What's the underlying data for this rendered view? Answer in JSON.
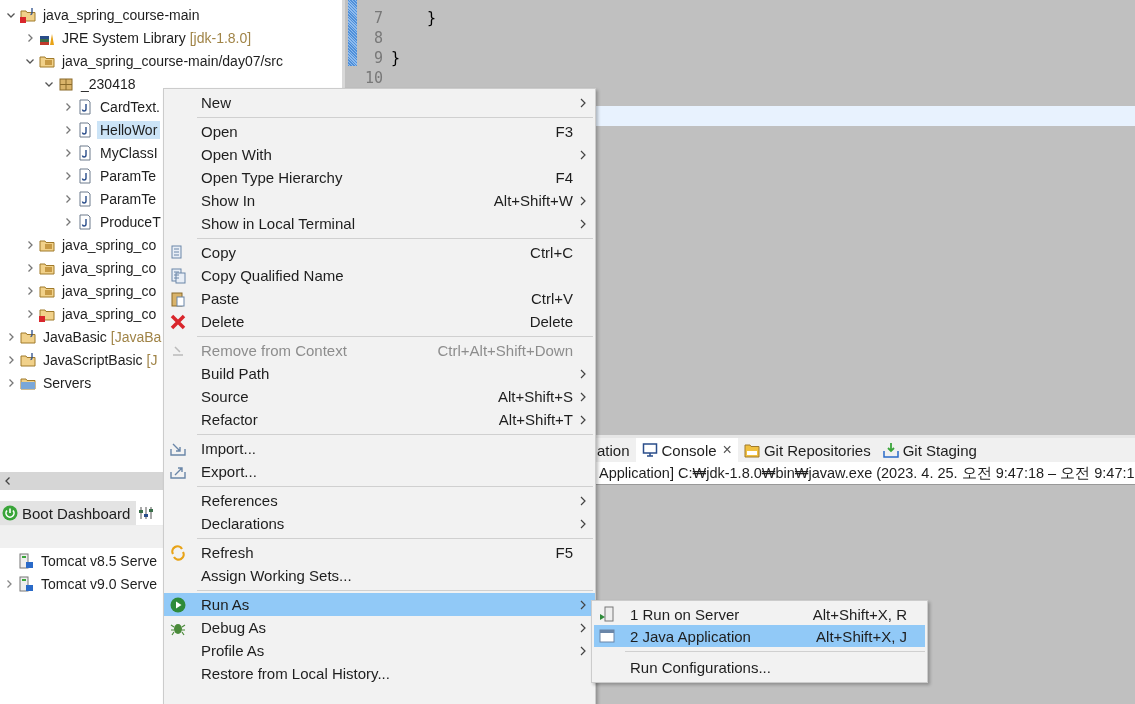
{
  "explorer": {
    "tree": [
      {
        "label": "java_spring_course-main",
        "kind": "project-error",
        "expanded": true,
        "selected": false,
        "children": [
          {
            "label": "JRE System Library",
            "decoration": "[jdk-1.8.0]",
            "kind": "library",
            "expanded": false,
            "selected": false
          },
          {
            "label": "java_spring_course-main/day07/src",
            "kind": "source-folder",
            "expanded": true,
            "selected": false,
            "children": [
              {
                "label": "_230418",
                "kind": "package",
                "expanded": true,
                "selected": false,
                "children": [
                  {
                    "label": "CardText.",
                    "kind": "java-file",
                    "expanded": false,
                    "selected": false
                  },
                  {
                    "label": "HelloWor",
                    "kind": "java-file",
                    "expanded": false,
                    "selected": true
                  },
                  {
                    "label": "MyClassI",
                    "kind": "java-file",
                    "expanded": false,
                    "selected": false
                  },
                  {
                    "label": "ParamTe",
                    "kind": "java-file",
                    "expanded": false,
                    "selected": false
                  },
                  {
                    "label": "ParamTe",
                    "kind": "java-file",
                    "expanded": false,
                    "selected": false
                  },
                  {
                    "label": "ProduceT",
                    "kind": "java-file",
                    "expanded": false,
                    "selected": false
                  }
                ]
              }
            ]
          },
          {
            "label": "java_spring_co",
            "kind": "source-folder",
            "expanded": false,
            "selected": false
          },
          {
            "label": "java_spring_co",
            "kind": "source-folder",
            "expanded": false,
            "selected": false
          },
          {
            "label": "java_spring_co",
            "kind": "source-folder",
            "expanded": false,
            "selected": false
          },
          {
            "label": "java_spring_co",
            "kind": "folder-error",
            "expanded": false,
            "selected": false
          }
        ]
      },
      {
        "label": "JavaBasic",
        "decoration": "[JavaBa",
        "kind": "project",
        "expanded": false,
        "selected": false
      },
      {
        "label": "JavaScriptBasic",
        "decoration": "[J",
        "kind": "project",
        "expanded": false,
        "selected": false
      },
      {
        "label": "Servers",
        "kind": "folder",
        "expanded": false,
        "selected": false
      }
    ]
  },
  "editor": {
    "lines": [
      {
        "number": "7",
        "text": "    }"
      },
      {
        "number": "8"
      },
      {
        "number": "9",
        "text": "}"
      },
      {
        "number": "10"
      }
    ]
  },
  "boot_panel": {
    "tabs": [
      {
        "label": "Boot Dashboard",
        "kind": "power",
        "selected": true
      },
      {
        "kind": "sliders",
        "selected": false
      }
    ],
    "servers": [
      {
        "label": "Tomcat v8.5 Serve"
      },
      {
        "label": "Tomcat v9.0 Serve",
        "expanded": false
      }
    ]
  },
  "console_panel": {
    "tabs": [
      {
        "label": "ation",
        "kind": "plain",
        "selected": false
      },
      {
        "label": "Console",
        "kind": "monitor",
        "close": "×",
        "selected": true
      },
      {
        "label": "Git Repositories",
        "kind": "git",
        "selected": false
      },
      {
        "label": "Git Staging",
        "kind": "staging",
        "selected": false
      }
    ],
    "header": "Application] C:₩jdk-1.8.0₩bin₩javaw.exe  (2023. 4. 25. 오전 9:47:18 – 오전 9:47:1"
  },
  "context_menu": {
    "items": [
      {
        "kind": "plain",
        "label": "New",
        "submenu": true,
        "selected": false,
        "disabled": false
      },
      {
        "kind": "separator"
      },
      {
        "kind": "plain",
        "label": "Open",
        "shortcut": "F3",
        "selected": false,
        "disabled": false
      },
      {
        "kind": "plain",
        "label": "Open With",
        "submenu": true,
        "selected": false,
        "disabled": false
      },
      {
        "kind": "plain",
        "label": "Open Type Hierarchy",
        "shortcut": "F4",
        "selected": false,
        "disabled": false
      },
      {
        "kind": "plain",
        "label": "Show In",
        "shortcut": "Alt+Shift+W",
        "submenu": true,
        "selected": false,
        "disabled": false
      },
      {
        "kind": "plain",
        "label": "Show in Local Terminal",
        "submenu": true,
        "selected": false,
        "disabled": false
      },
      {
        "kind": "separator"
      },
      {
        "kind": "copy",
        "label": "Copy",
        "shortcut": "Ctrl+C",
        "selected": false,
        "disabled": false
      },
      {
        "kind": "copyname",
        "label": "Copy Qualified Name",
        "selected": false,
        "disabled": false
      },
      {
        "kind": "paste",
        "label": "Paste",
        "shortcut": "Ctrl+V",
        "selected": false,
        "disabled": false
      },
      {
        "kind": "delete",
        "label": "Delete",
        "shortcut": "Delete",
        "selected": false,
        "disabled": false
      },
      {
        "kind": "separator"
      },
      {
        "kind": "remove",
        "label": "Remove from Context",
        "shortcut": "Ctrl+Alt+Shift+Down",
        "selected": false,
        "disabled": true
      },
      {
        "kind": "plain",
        "label": "Build Path",
        "submenu": true,
        "selected": false,
        "disabled": false
      },
      {
        "kind": "plain",
        "label": "Source",
        "shortcut": "Alt+Shift+S",
        "submenu": true,
        "selected": false,
        "disabled": false
      },
      {
        "kind": "plain",
        "label": "Refactor",
        "shortcut": "Alt+Shift+T",
        "submenu": true,
        "selected": false,
        "disabled": false
      },
      {
        "kind": "separator"
      },
      {
        "kind": "import",
        "label": "Import...",
        "selected": false,
        "disabled": false
      },
      {
        "kind": "export",
        "label": "Export...",
        "selected": false,
        "disabled": false
      },
      {
        "kind": "separator"
      },
      {
        "kind": "plain",
        "label": "References",
        "submenu": true,
        "selected": false,
        "disabled": false
      },
      {
        "kind": "plain",
        "label": "Declarations",
        "submenu": true,
        "selected": false,
        "disabled": false
      },
      {
        "kind": "separator"
      },
      {
        "kind": "refresh",
        "label": "Refresh",
        "shortcut": "F5",
        "selected": false,
        "disabled": false
      },
      {
        "kind": "plain",
        "label": "Assign Working Sets...",
        "selected": false,
        "disabled": false
      },
      {
        "kind": "separator"
      },
      {
        "kind": "run",
        "label": "Run As",
        "submenu": true,
        "selected": true,
        "disabled": false
      },
      {
        "kind": "debug",
        "label": "Debug As",
        "submenu": true,
        "selected": false,
        "disabled": false
      },
      {
        "kind": "plain",
        "label": "Profile As",
        "submenu": true,
        "selected": false,
        "disabled": false
      },
      {
        "kind": "plain",
        "label": "Restore from Local History...",
        "selected": false,
        "disabled": false
      }
    ]
  },
  "submenu": {
    "items": [
      {
        "kind": "server",
        "label": "1 Run on Server",
        "shortcut": "Alt+Shift+X, R",
        "selected": false
      },
      {
        "kind": "javaapp",
        "label": "2 Java Application",
        "shortcut": "Alt+Shift+X, J",
        "selected": true
      },
      {
        "kind": "separator"
      },
      {
        "kind": "plain",
        "label": "Run Configurations...",
        "selected": false
      }
    ]
  }
}
